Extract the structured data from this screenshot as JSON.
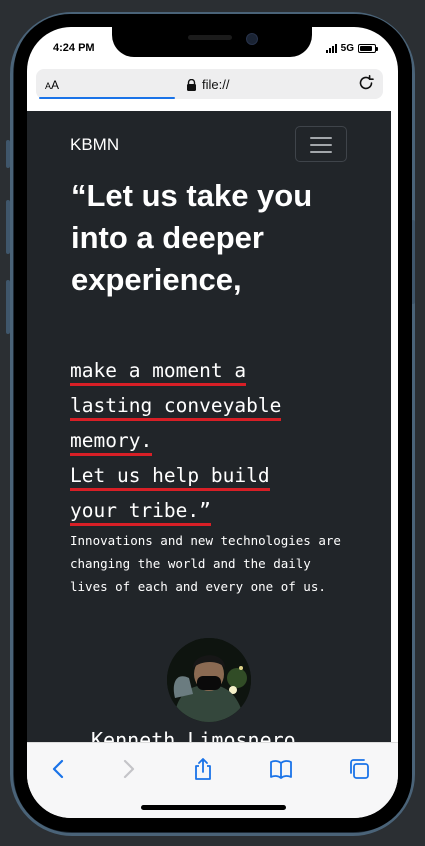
{
  "status_bar": {
    "time": "4:24 PM",
    "network": "5G",
    "battery_level": 0.85,
    "signal_icon": "cellular-signal-icon",
    "battery_icon": "battery-icon"
  },
  "browser": {
    "text_size_label_small": "A",
    "text_size_label_large": "A",
    "url": "file://",
    "lock_icon": "lock-icon",
    "reload_icon": "reload-icon",
    "load_progress": 0.4
  },
  "site": {
    "brand": "KBMN",
    "menu_icon": "hamburger-menu-icon",
    "hero_heading": "“Let us take you into a deeper experience,",
    "sublines": [
      "make a moment a",
      "lasting conveyable",
      "memory.",
      "Let us help build",
      "your tribe.”"
    ],
    "body": "Innovations and new technologies are changing the world and the daily lives of each and every one of us.",
    "profile_name": "Kenneth Limosnero"
  },
  "toolbar": {
    "back_icon": "chevron-left-icon",
    "forward_icon": "chevron-right-icon",
    "share_icon": "share-icon",
    "bookmarks_icon": "book-icon",
    "tabs_icon": "tabs-icon"
  },
  "colors": {
    "page_background": "#212529",
    "accent_underline": "#d81f26",
    "browser_blue": "#1a73e8"
  }
}
